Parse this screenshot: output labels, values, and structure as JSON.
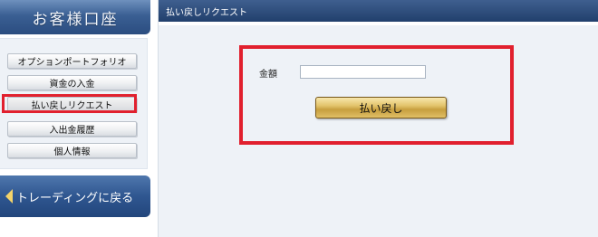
{
  "sidebar": {
    "header": "お客様口座",
    "items": [
      {
        "label": "オプションポートフォリオ"
      },
      {
        "label": "資金の入金"
      },
      {
        "label": "払い戻しリクエスト",
        "active": true
      },
      {
        "label": "入出金履歴"
      },
      {
        "label": "個人情報"
      }
    ],
    "back_label": "トレーディングに戻る"
  },
  "main": {
    "title": "払い戻しリクエスト",
    "amount_label": "金額",
    "amount_value": "",
    "submit_label": "払い戻し"
  },
  "colors": {
    "highlight": "#e1202e",
    "header_blue": "#2b4d80",
    "button_gold": "#e3c46b"
  }
}
